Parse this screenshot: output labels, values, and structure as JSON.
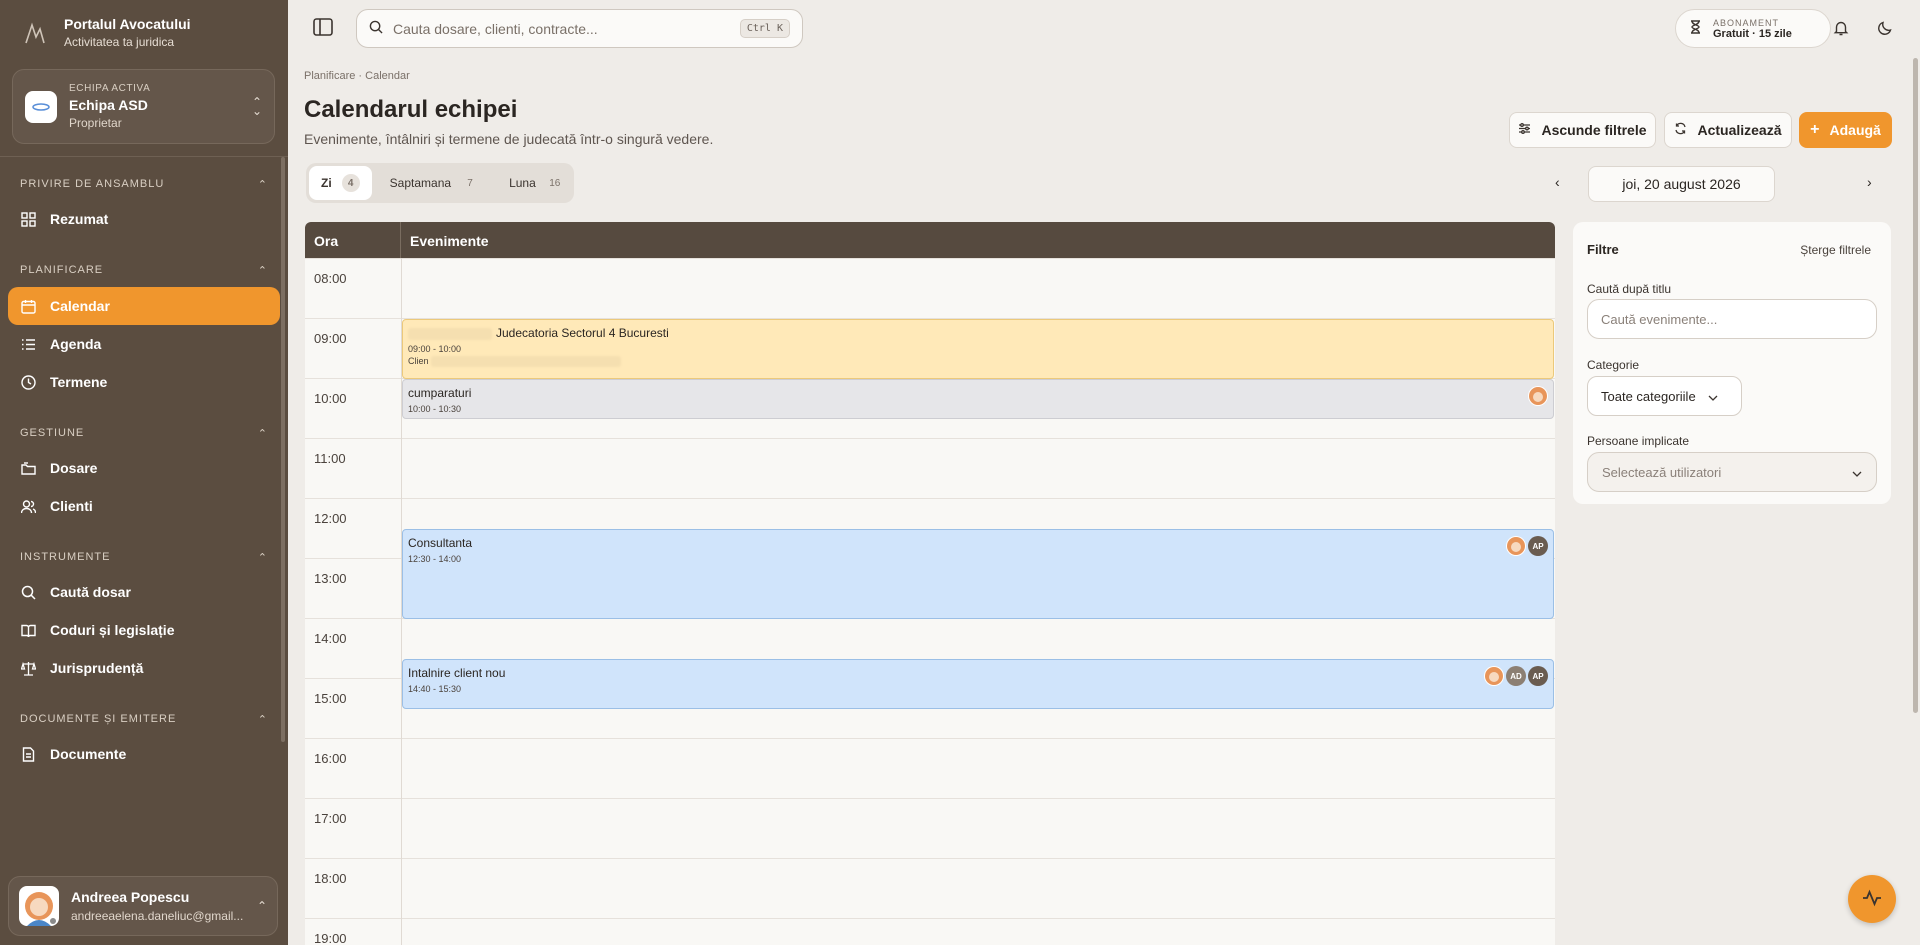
{
  "brand": {
    "title": "Portalul Avocatului",
    "subtitle": "Activitatea ta juridica"
  },
  "team": {
    "label": "ECHIPA ACTIVA",
    "name": "Echipa ASD",
    "role": "Proprietar"
  },
  "sidebar": {
    "sections": [
      {
        "title": "PRIVIRE DE ANSAMBLU",
        "items": [
          {
            "label": "Rezumat",
            "icon": "grid-icon"
          }
        ]
      },
      {
        "title": "PLANIFICARE",
        "items": [
          {
            "label": "Calendar",
            "icon": "calendar-icon",
            "active": true
          },
          {
            "label": "Agenda",
            "icon": "list-icon"
          },
          {
            "label": "Termene",
            "icon": "clock-icon"
          }
        ]
      },
      {
        "title": "GESTIUNE",
        "items": [
          {
            "label": "Dosare",
            "icon": "folder-icon"
          },
          {
            "label": "Clienti",
            "icon": "users-icon"
          }
        ]
      },
      {
        "title": "INSTRUMENTE",
        "items": [
          {
            "label": "Caută dosar",
            "icon": "search-icon"
          },
          {
            "label": "Coduri și legislație",
            "icon": "book-icon"
          },
          {
            "label": "Jurisprudență",
            "icon": "scale-icon"
          }
        ]
      },
      {
        "title": "DOCUMENTE ȘI EMITERE",
        "items": [
          {
            "label": "Documente",
            "icon": "document-icon"
          }
        ]
      }
    ]
  },
  "user": {
    "name": "Andreea Popescu",
    "email": "andreeaelena.daneliuc@gmail..."
  },
  "search": {
    "placeholder": "Cauta dosare, clienti, contracte...",
    "shortcut": "Ctrl K"
  },
  "subscription": {
    "label": "ABONAMENT",
    "value": "Gratuit · 15 zile"
  },
  "header": {
    "breadcrumb": "Planificare · Calendar",
    "title": "Calendarul echipei",
    "subtitle": "Evenimente, întâlniri și termene de judecată într-o singură vedere.",
    "hide_filters": "Ascunde filtrele",
    "refresh": "Actualizează",
    "add": "Adaugă"
  },
  "view_tabs": [
    {
      "label": "Zi",
      "count": "4",
      "active": true
    },
    {
      "label": "Saptamana",
      "count": "7"
    },
    {
      "label": "Luna",
      "count": "16"
    }
  ],
  "date": {
    "current": "joi, 20 august 2026"
  },
  "calendar": {
    "col_hour": "Ora",
    "col_events": "Evenimente",
    "hours": [
      "08:00",
      "09:00",
      "10:00",
      "11:00",
      "12:00",
      "13:00",
      "14:00",
      "15:00",
      "16:00",
      "17:00",
      "18:00",
      "19:00"
    ],
    "events": [
      {
        "title": "Judecatoria Sectorul 4 Bucuresti",
        "time": "09:00 - 10:00",
        "extra": "Clien",
        "color": "#ffe9b8",
        "border": "#ecc97a"
      },
      {
        "title": "cumparaturi",
        "time": "10:00 - 10:30",
        "color": "#e6e6e9",
        "border": "#cdcdd2"
      },
      {
        "title": "Consultanta",
        "time": "12:30 - 14:00",
        "color": "#d0e4fb",
        "border": "#9bbfe6"
      },
      {
        "title": "Intalnire client nou",
        "time": "14:40 - 15:30",
        "color": "#d0e4fb",
        "border": "#9bbfe6"
      }
    ],
    "avatars": {
      "ap": "AP",
      "ad": "AD"
    }
  },
  "filters": {
    "title": "Filtre",
    "clear": "Șterge filtrele",
    "title_label": "Caută după titlu",
    "title_placeholder": "Caută evenimente...",
    "category_label": "Categorie",
    "category_value": "Toate categoriile",
    "people_label": "Persoane implicate",
    "people_placeholder": "Selectează utilizatori"
  },
  "colors": {
    "accent": "#f0962d",
    "sidebar": "#5b4d40",
    "table_header": "#564a3f"
  }
}
